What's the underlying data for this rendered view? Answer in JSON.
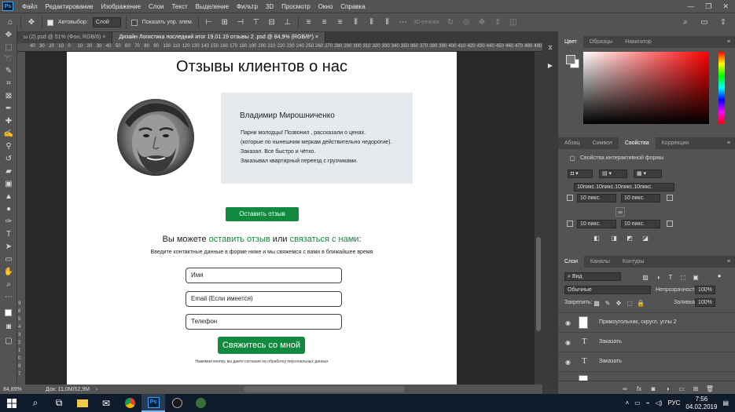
{
  "app": {
    "logo": "Ps",
    "menu": [
      "Файл",
      "Редактирование",
      "Изображение",
      "Слои",
      "Текст",
      "Выделение",
      "Фильтр",
      "3D",
      "Просмотр",
      "Окно",
      "Справка"
    ],
    "window_controls": [
      "—",
      "❐",
      "✕"
    ]
  },
  "options_bar": {
    "autoselect_label": "Автовыбор:",
    "autoselect_value": "Слой",
    "show_controls_label": "Показать упр. элем.",
    "mode_3d": "3D-режим:"
  },
  "tabs": [
    {
      "label": "ы (2).psd @ 51% (Фон, RGB/8) ×",
      "active": false
    },
    {
      "label": "Дизайн Логистика последний итог 19.01.19 отзывы 2  .psd @ 84,9% (RGB/8*) ×",
      "active": true
    }
  ],
  "ruler": {
    "top": [
      "40",
      "30",
      "20",
      "10",
      "0",
      "10",
      "20",
      "30",
      "40",
      "50",
      "60",
      "70",
      "80",
      "90",
      "100",
      "110",
      "120",
      "130",
      "140",
      "150",
      "160",
      "170",
      "180",
      "190",
      "200",
      "210",
      "220",
      "230",
      "240",
      "250",
      "260",
      "270",
      "280",
      "290",
      "300",
      "310",
      "320",
      "330",
      "340",
      "350",
      "360",
      "370",
      "380",
      "390",
      "400",
      "410",
      "420",
      "430",
      "440",
      "450",
      "460",
      "470",
      "480",
      "490",
      "50"
    ],
    "left": [
      "9",
      "8",
      "5",
      "4",
      "3",
      "2",
      "1",
      "0",
      "8",
      "7"
    ]
  },
  "document": {
    "title": "Отзывы клиентов о нас",
    "reviewer_name": "Владимир Мирошниченко",
    "review_lines": [
      "Парни молодцы! Позвонил , рассказали о ценах.",
      "(которые по нынешним меркам действительно недорогие).",
      "Заказал. Все быстро и чётко.",
      "Заказывал квартирный переезд с грузчиками."
    ],
    "review_button": "Оставить отзыв",
    "cta_prefix": "Вы можете ",
    "cta_link1": "оставить отзыв",
    "cta_mid": " или ",
    "cta_link2": "связаться с нами",
    "cta_suffix": ":",
    "cta_subtext": "Введите контактные данные в форме ниже и мы свяжемся с вами в ближайшее время",
    "fields": [
      "Имя",
      "Email (Если имеется)",
      "Телефон"
    ],
    "submit_button": "Свяжитесь со мной",
    "fine_print": "Нажимая кнопку, вы даете согласие на обработку персональных данных"
  },
  "status": {
    "zoom": "84,89%",
    "doc_size": "Док: 11,0М/52,9М"
  },
  "panels": {
    "color_tabs": [
      "Цвет",
      "Образцы",
      "Навигатор"
    ],
    "props_tabs": [
      "Абзац",
      "Символ",
      "Свойства",
      "Коррекция"
    ],
    "props_title": "Свойства интерактивной формы",
    "props_radii_all": "10пикс.10пикс.10пикс.10пикс.",
    "props_radius": "10 пикс.",
    "layers_tabs": [
      "Слои",
      "Каналы",
      "Контуры"
    ],
    "layer_kind": "Вид",
    "blend_mode": "Обычные",
    "opacity_label": "Непрозрачность:",
    "opacity_value": "100%",
    "lock_label": "Закрепить:",
    "fill_label": "Заливка:",
    "fill_value": "100%",
    "layers": [
      {
        "name": "Прямоугольник, скругл. углы 2",
        "type": "shape"
      },
      {
        "name": "Заказать",
        "type": "text"
      },
      {
        "name": "Заказать",
        "type": "text"
      }
    ]
  },
  "taskbar": {
    "lang": "РУС",
    "time": "7:56",
    "date": "04.02.2019"
  },
  "colors": {
    "brand_green": "#11893f",
    "ps_blue": "#31a8ff"
  }
}
